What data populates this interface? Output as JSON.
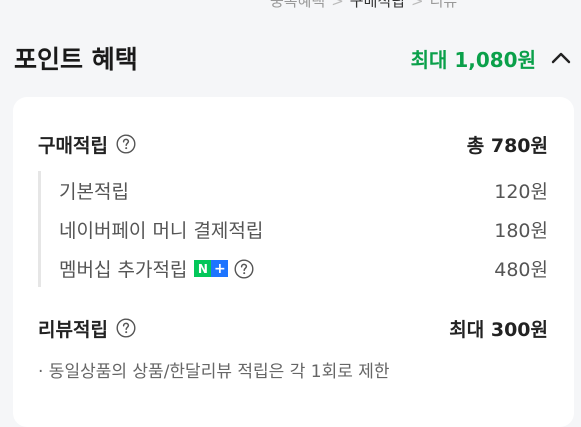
{
  "breadcrumb": {
    "items": [
      "중복혜택",
      "구매적립",
      "리뷰"
    ]
  },
  "header": {
    "title": "포인트 혜택",
    "max_benefit": "최대 1,080원"
  },
  "purchase": {
    "label": "구매적립",
    "total": "총 780원",
    "items": [
      {
        "label": "기본적립",
        "value": "120원"
      },
      {
        "label": "네이버페이 머니 결제적립",
        "value": "180원"
      },
      {
        "label": "멤버십 추가적립",
        "value": "480원",
        "badge": "N+"
      }
    ]
  },
  "review": {
    "label": "리뷰적립",
    "value": "최대 300원",
    "note": "· 동일상품의 상품/한달리뷰 적립은 각 1회로 제한"
  },
  "colors": {
    "accent_green": "#0aa04a",
    "naver_green": "#03c75a",
    "plus_blue": "#1d74ff"
  },
  "icons": [
    "question-circle-icon",
    "chevron-up-icon",
    "naver-plus-membership-icon"
  ]
}
